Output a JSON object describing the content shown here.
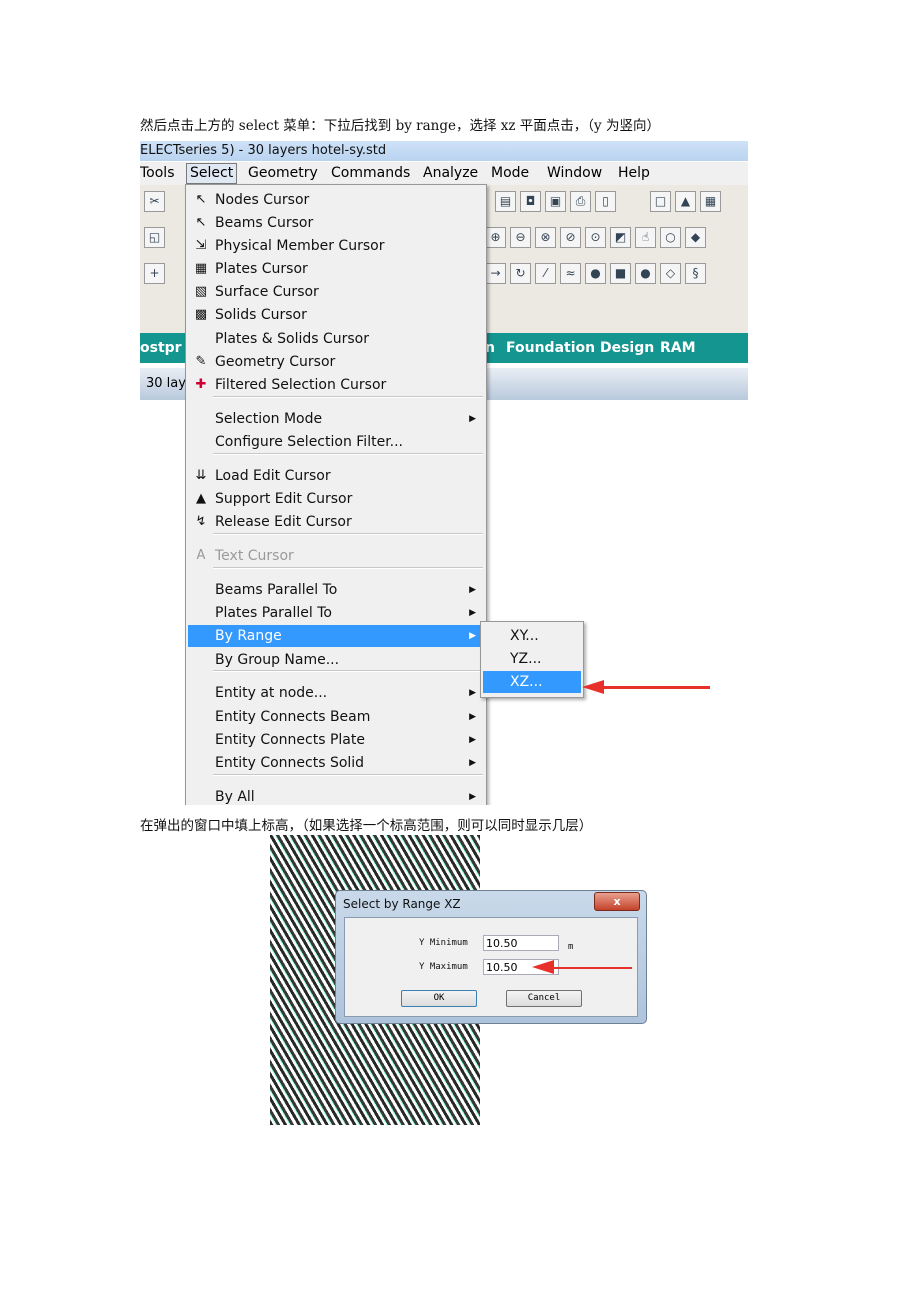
{
  "text": {
    "para1": "然后点击上方的 select 菜单：下拉后找到 by range，选择 xz 平面点击，（y 为竖向）",
    "para2": "在弹出的窗口中填上标高，（如果选择一个标高范围，则可以同时显示几层）"
  },
  "app": {
    "title": "ELECTseries 5) - 30 layers hotel-sy.std",
    "menubar": [
      "Tools",
      "Select",
      "Geometry",
      "Commands",
      "Analyze",
      "Mode",
      "Window",
      "Help"
    ],
    "teal_tabs": [
      "ostpr",
      "n",
      "Foundation Design",
      "RAM Conne"
    ],
    "status": "30 lay"
  },
  "menu": {
    "items": [
      {
        "label": "Nodes Cursor",
        "icon": "nodes-cursor-icon"
      },
      {
        "label": "Beams Cursor",
        "icon": "beams-cursor-icon"
      },
      {
        "label": "Physical Member Cursor",
        "icon": "physical-member-icon"
      },
      {
        "label": "Plates Cursor",
        "icon": "plates-cursor-icon"
      },
      {
        "label": "Surface Cursor",
        "icon": "surface-cursor-icon"
      },
      {
        "label": "Solids Cursor",
        "icon": "solids-cursor-icon"
      },
      {
        "label": "Plates & Solids Cursor"
      },
      {
        "label": "Geometry Cursor",
        "icon": "geometry-cursor-icon"
      },
      {
        "label": "Filtered Selection Cursor",
        "icon": "filter-cross-icon"
      },
      {
        "label": "Selection Mode"
      },
      {
        "label": "Configure Selection Filter..."
      },
      {
        "label": "Load Edit Cursor",
        "icon": "load-edit-icon"
      },
      {
        "label": "Support Edit Cursor",
        "icon": "support-edit-icon"
      },
      {
        "label": "Release Edit Cursor",
        "icon": "release-edit-icon"
      },
      {
        "label": "Text Cursor",
        "icon": "text-cursor-icon",
        "disabled": true
      },
      {
        "label": "Beams Parallel To"
      },
      {
        "label": "Plates Parallel To"
      },
      {
        "label": "By Range",
        "highlighted": true
      },
      {
        "label": "By Group Name..."
      },
      {
        "label": "Entity at node..."
      },
      {
        "label": "Entity Connects Beam"
      },
      {
        "label": "Entity Connects Plate"
      },
      {
        "label": "Entity Connects Solid"
      },
      {
        "label": "By All"
      }
    ],
    "submenu": [
      "XY...",
      "YZ...",
      "XZ..."
    ],
    "highlight_color": "#3399ff"
  },
  "dialog": {
    "title": "Select by Range XZ",
    "close": "x",
    "ymin_label": "Y Minimum",
    "ymin": "10.50",
    "ymax_label": "Y Maximum",
    "ymax": "10.50",
    "unit": "m",
    "ok": "OK",
    "cancel": "Cancel"
  },
  "colors": {
    "arrow": "#e8302a",
    "teal": "#14958f"
  }
}
